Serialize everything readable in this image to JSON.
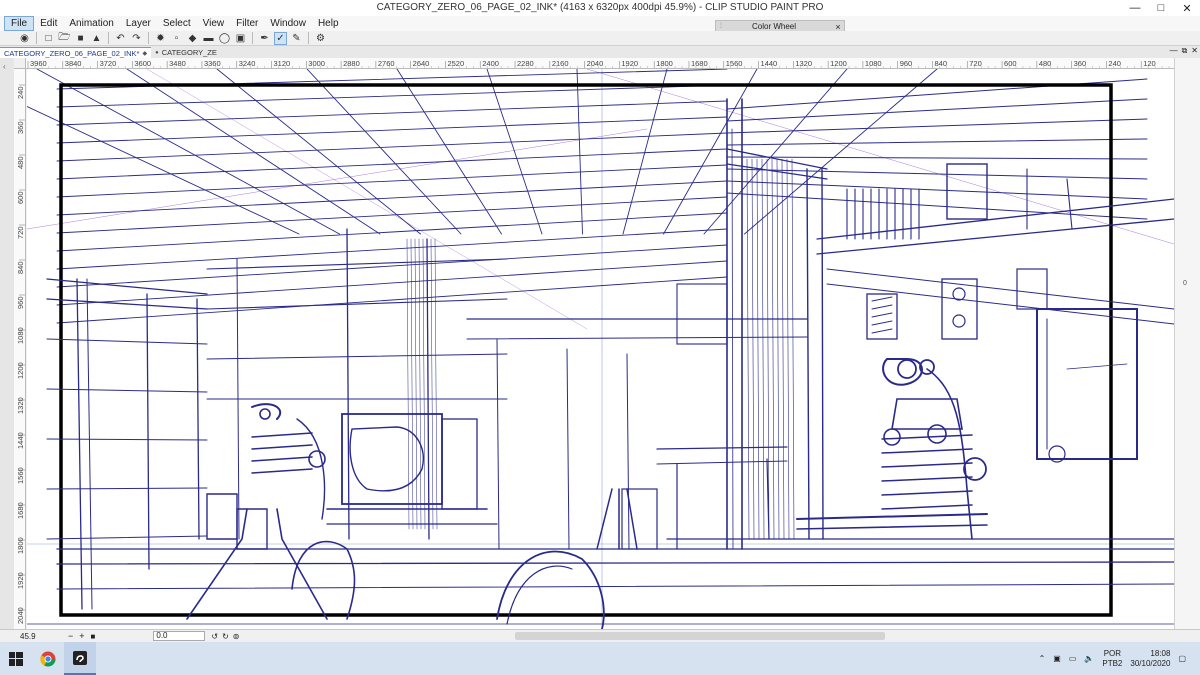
{
  "window": {
    "title": "CATEGORY_ZERO_06_PAGE_02_INK* (4163 x 6320px 400dpi 45.9%) - CLIP STUDIO PAINT PRO",
    "minimize_icon": "minimize-icon",
    "maximize_icon": "maximize-icon",
    "close_icon": "close-icon"
  },
  "menu": {
    "items": [
      "File",
      "Edit",
      "Animation",
      "Layer",
      "Select",
      "View",
      "Filter",
      "Window",
      "Help"
    ],
    "active": "File"
  },
  "toolbar": {
    "icons": [
      "clip-studio-icon",
      "new-icon",
      "open-icon",
      "save-icon",
      "export-icon",
      "undo-icon",
      "redo-icon",
      "lasso-icon",
      "clear-icon",
      "fill-icon",
      "eraser-icon",
      "transform-icon",
      "pen-icon",
      "pen-active-icon",
      "pressure-icon",
      "settings-icon"
    ]
  },
  "color_wheel_panel": {
    "label": "Color Wheel",
    "close": "×"
  },
  "doc_tabs": [
    {
      "label": "CATEGORY_ZERO_06_PAGE_02_INK*",
      "active": true
    },
    {
      "label": "CATEGORY_ZE",
      "active": false
    }
  ],
  "ruler_top": {
    "labels": [
      "3960",
      "3840",
      "3720",
      "3600",
      "3480",
      "3360",
      "3240",
      "3120",
      "3000",
      "2880",
      "2760",
      "2640",
      "2520",
      "2400",
      "2280",
      "2160",
      "2040",
      "1920",
      "1800",
      "1680",
      "1560",
      "1440",
      "1320",
      "1200",
      "1080",
      "960",
      "840",
      "720",
      "600",
      "480",
      "360",
      "240",
      "120"
    ]
  },
  "ruler_left": {
    "labels": [
      "240",
      "360",
      "480",
      "600",
      "720",
      "840",
      "960",
      "1080",
      "1200",
      "1320",
      "1440",
      "1560",
      "1680",
      "1800",
      "1920",
      "2040"
    ]
  },
  "statusbar": {
    "zoom": "45.9",
    "rotation": "0.0"
  },
  "taskbar": {
    "apps": [
      "windows-start-icon",
      "chrome-icon",
      "clip-studio-icon"
    ],
    "lang_top": "POR",
    "lang_bottom": "PTB2",
    "time": "18:08",
    "date": "30/10/2020"
  },
  "colors": {
    "ink": "#2a2a8a",
    "guide": "#b07ad8",
    "guide_blue": "#8fa6e0"
  }
}
